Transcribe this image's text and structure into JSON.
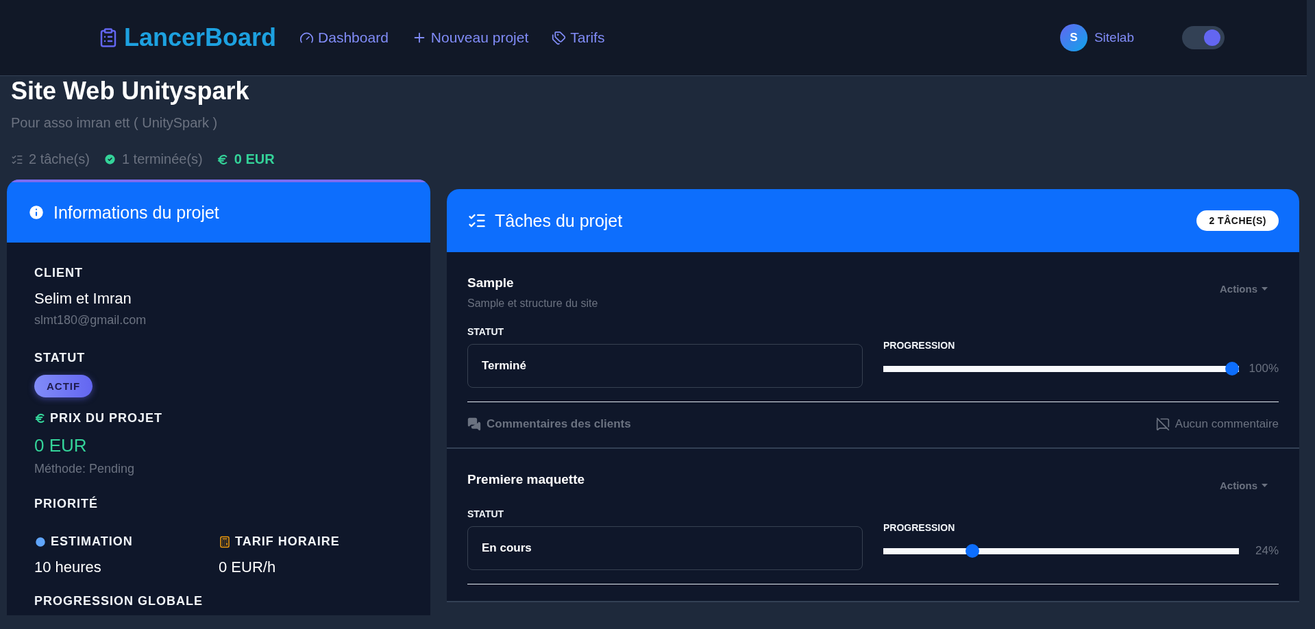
{
  "nav": {
    "brand": "LancerBoard",
    "links": [
      {
        "label": "Dashboard"
      },
      {
        "label": "Nouveau projet"
      },
      {
        "label": "Tarifs"
      }
    ],
    "user": {
      "initial": "S",
      "name": "Sitelab"
    },
    "dark_mode": {
      "on": true
    }
  },
  "project": {
    "title": "Site Web Unityspark",
    "subtitle": "Pour asso imran ett ( UnitySpark )",
    "stats": [
      {
        "kind": "tasks",
        "text": "2 tâche(s)"
      },
      {
        "kind": "done",
        "text": "1 terminée(s)"
      },
      {
        "kind": "price",
        "text": "0 EUR"
      }
    ]
  },
  "info_card": {
    "title": "Informations du projet",
    "client_label": "CLIENT",
    "client_name": "Selim et Imran",
    "client_email": "slmt180@gmail.com",
    "status_label": "STATUT",
    "status_badge": "ACTIF",
    "price_label": "PRIX DU PROJET",
    "price": "0 EUR",
    "method": "Méthode: Pending",
    "priority_label": "PRIORITÉ",
    "estimation_label": "ESTIMATION",
    "estimation": "10 heures",
    "rate_label": "TARIF HORAIRE",
    "rate": "0 EUR/h",
    "progress_label": "PROGRESSION GLOBALE"
  },
  "tasks_card": {
    "title": "Tâches du projet",
    "count_badge": "2 TÂCHE(S)",
    "tasks": [
      {
        "name": "Sample",
        "description": "Sample et structure du site",
        "actions": "Actions",
        "status_label": "STATUT",
        "status": "Terminé",
        "progress_label": "PROGRESSION",
        "level": 1,
        "percent": "100%",
        "comments_label": "Commentaires des clients",
        "comments_state": "Aucun commentaire"
      },
      {
        "name": "Premiere maquette",
        "actions": "Actions",
        "status_label": "STATUT",
        "status": "En cours",
        "progress_label": "PROGRESSION",
        "level": 0.24,
        "percent": "24%"
      }
    ]
  }
}
